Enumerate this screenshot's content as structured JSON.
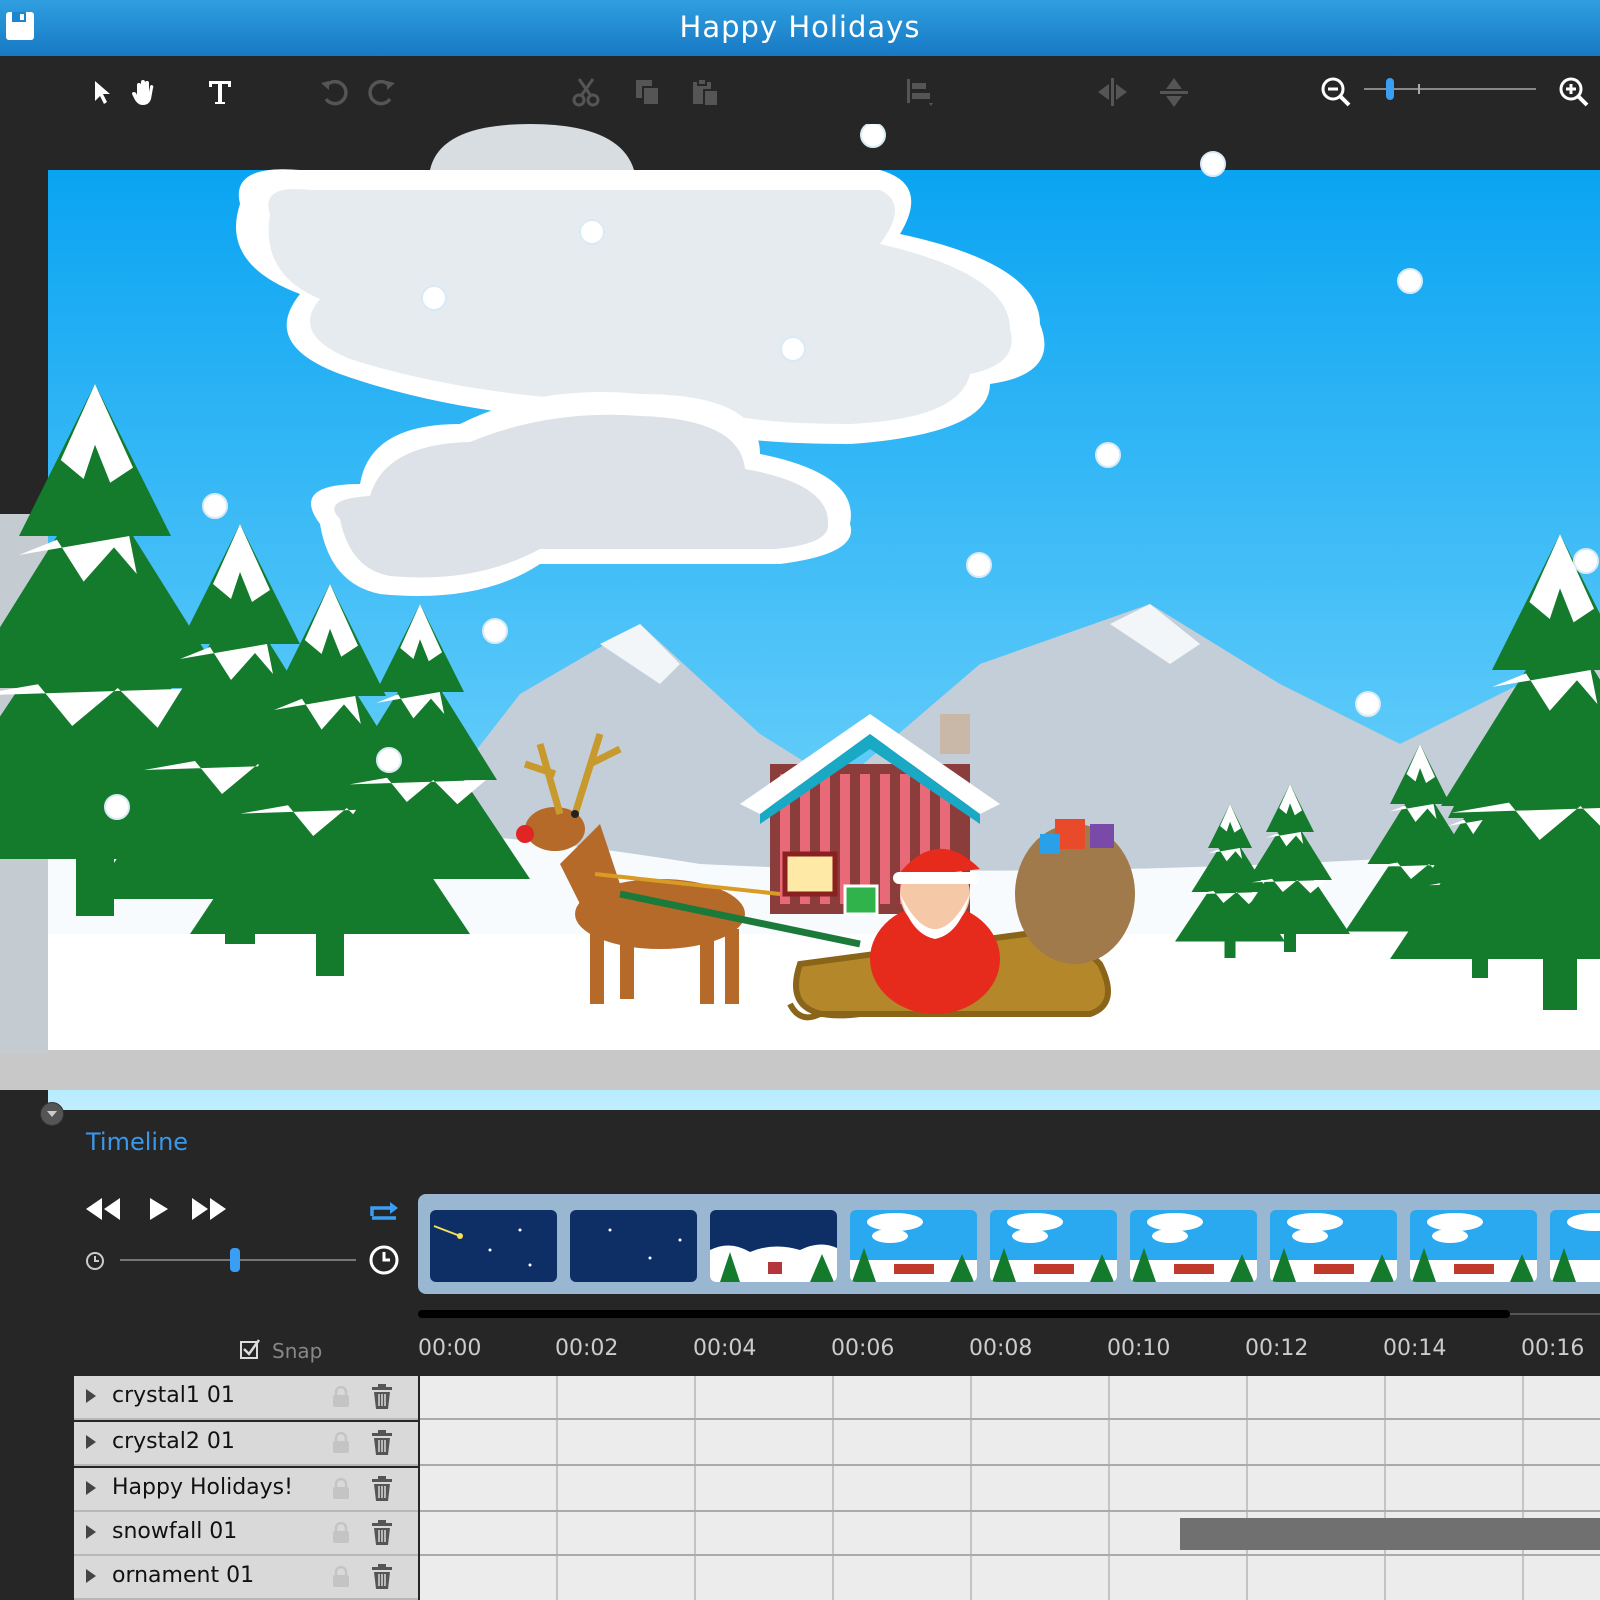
{
  "window": {
    "title": "Happy Holidays"
  },
  "icons": {
    "save": "save-icon",
    "select": "pointer-icon",
    "pan": "hand-icon",
    "text": "text-icon",
    "undo": "undo-icon",
    "redo": "redo-icon",
    "cut": "cut-icon",
    "copy": "copy-icon",
    "paste": "paste-icon",
    "align": "align-icon",
    "flip_h": "flip-horizontal-icon",
    "flip_v": "flip-vertical-icon",
    "zoom_out": "zoom-out-icon",
    "zoom_in": "zoom-in-icon"
  },
  "toolbar": {
    "zoom_level": 0.13
  },
  "timeline": {
    "label": "Timeline",
    "snap_label": "Snap",
    "snap_checked": true,
    "speed_level": 0.5,
    "ruler": [
      "00:00",
      "00:02",
      "00:04",
      "00:06",
      "00:08",
      "00:10",
      "00:12",
      "00:14",
      "00:16"
    ],
    "layers": [
      {
        "name": "crystal1 01"
      },
      {
        "name": "crystal2 01"
      },
      {
        "name": "Happy Holidays!"
      },
      {
        "name": "snowfall 01"
      },
      {
        "name": "ornament 01"
      }
    ]
  },
  "colors": {
    "accent": "#3b9ef5",
    "titlebar": "#2393d9",
    "sky": "#1ba5f0",
    "tree": "#1c7a2e",
    "snow": "#ffffff"
  }
}
